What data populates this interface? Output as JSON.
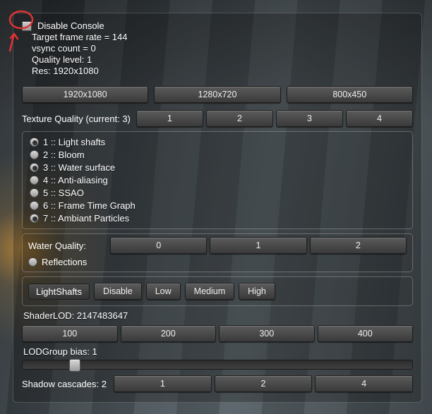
{
  "disable_console_label": "Disable Console",
  "info": {
    "target_frame_rate": "Target frame rate = 144",
    "vsync_count": "vsync count = 0",
    "quality_level": "Quality level: 1",
    "res": "Res: 1920x1080"
  },
  "res_buttons": [
    "1920x1080",
    "1280x720",
    "800x450"
  ],
  "texture_quality_label": "Texture Quality (current: 3)",
  "texture_quality_buttons": [
    "1",
    "2",
    "3",
    "4"
  ],
  "feature_toggles": [
    {
      "label": "1 :: Light shafts",
      "on": true
    },
    {
      "label": "2 :: Bloom",
      "on": false
    },
    {
      "label": "3 :: Water surface",
      "on": true
    },
    {
      "label": "4 :: Anti-aliasing",
      "on": false
    },
    {
      "label": "5 :: SSAO",
      "on": false
    },
    {
      "label": "6 :: Frame Time Graph",
      "on": false
    },
    {
      "label": "7 :: Ambiant Particles",
      "on": true
    }
  ],
  "water_quality_label": "Water Quality:",
  "water_quality_buttons": [
    "0",
    "1",
    "2"
  ],
  "reflections_label": "Reflections",
  "lightshafts": {
    "title": "LightShafts",
    "buttons": [
      "Disable",
      "Low",
      "Medium",
      "High"
    ]
  },
  "shader_lod_label": "ShaderLOD: 2147483647",
  "shader_lod_buttons": [
    "100",
    "200",
    "300",
    "400"
  ],
  "lodgroup_label": "LODGroup bias: 1",
  "lod_slider_pct": 12,
  "shadow_cascades_label": "Shadow cascades: 2",
  "shadow_cascades_buttons": [
    "1",
    "2",
    "4"
  ]
}
